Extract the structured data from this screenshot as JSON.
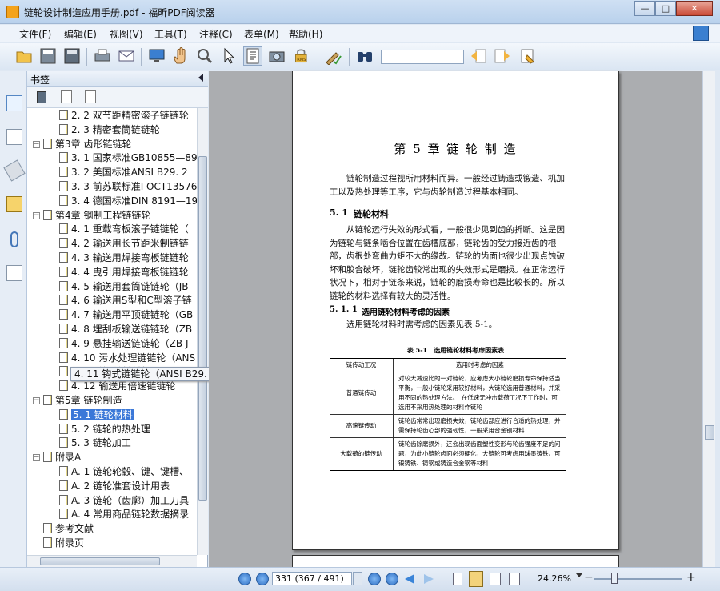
{
  "window": {
    "title": "链轮设计制造应用手册.pdf - 福昕PDF阅读器",
    "min": "—",
    "max": "□",
    "close": "✕"
  },
  "menu": [
    "文件(F)",
    "编辑(E)",
    "视图(V)",
    "工具(T)",
    "注释(C)",
    "表单(M)",
    "帮助(H)"
  ],
  "toolbar": {
    "icons": [
      "open-icon",
      "save-icon",
      "save-all-icon",
      "print-icon",
      "email-icon",
      "fullscreen-icon",
      "hand-icon",
      "zoom-loupe-icon",
      "select-pointer-icon",
      "text-select-icon",
      "snapshot-icon",
      "rms-lock-icon",
      "sign-icon",
      "binoculars-icon",
      "prev-find-icon",
      "next-find-icon",
      "highlight-icon"
    ],
    "search_placeholder": "",
    "rms": "RMS"
  },
  "panel": {
    "title": "书签"
  },
  "tree": [
    {
      "t": "2. 2 双节距精密滚子链链轮",
      "lv": 2
    },
    {
      "t": "2. 3 精密套筒链链轮",
      "lv": 2
    },
    {
      "t": "第3章 齿形链链轮",
      "lv": 1
    },
    {
      "t": "3. 1 国家标准GB10855—89",
      "lv": 2
    },
    {
      "t": "3. 2 美国标准ANSI B29. 2",
      "lv": 2
    },
    {
      "t": "3. 3 前苏联标准ГОСТ13576",
      "lv": 2
    },
    {
      "t": "3. 4 德国标准DIN 8191—19",
      "lv": 2
    },
    {
      "t": "第4章 钢制工程链链轮",
      "lv": 1
    },
    {
      "t": "4. 1 重载弯板滚子链链轮（",
      "lv": 2
    },
    {
      "t": "4. 2 输送用长节距米制链链",
      "lv": 2
    },
    {
      "t": "4. 3 输送用焊接弯板链链轮",
      "lv": 2
    },
    {
      "t": "4. 4 曳引用焊接弯板链链轮",
      "lv": 2
    },
    {
      "t": "4. 5 输送用套筒链链轮（JB",
      "lv": 2
    },
    {
      "t": "4. 6 输送用S型和C型滚子链",
      "lv": 2
    },
    {
      "t": "4. 7 输送用平顶链链轮（GB",
      "lv": 2
    },
    {
      "t": "4. 8 埋刮板输送链链轮（ZB",
      "lv": 2
    },
    {
      "t": "4. 9 悬挂输送链链轮（ZB J",
      "lv": 2
    },
    {
      "t": "4. 10 污水处理链链轮（ANS",
      "lv": 2
    },
    {
      "t": "4. 11 钩式链链轮（ANSI B29. 6—83）",
      "lv": 2
    },
    {
      "t": "4. 12 输送用倍速链链轮",
      "lv": 2
    },
    {
      "t": "第5章 链轮制造",
      "lv": 1
    },
    {
      "t": "5. 1 链轮材料",
      "lv": 2,
      "sel": true
    },
    {
      "t": "5. 2 链轮的热处理",
      "lv": 2
    },
    {
      "t": "5. 3 链轮加工",
      "lv": 2
    },
    {
      "t": "附录A",
      "lv": 1
    },
    {
      "t": "A. 1 链轮轮毂、键、键槽、",
      "lv": 2
    },
    {
      "t": "A. 2 链轮准套设计用表",
      "lv": 2
    },
    {
      "t": "A. 3 链轮（齿廓）加工刀具",
      "lv": 2
    },
    {
      "t": "A. 4 常用商品链轮数据摘录",
      "lv": 2
    },
    {
      "t": "参考文献",
      "lv": 1,
      "leaf": true
    },
    {
      "t": "附录页",
      "lv": 1,
      "leaf": true
    }
  ],
  "tooltip": "4. 11 钩式链链轮（ANSI B29. 6—83）",
  "doc": {
    "chapter": "第 5 章  链 轮 制 造",
    "intro": "链轮制造过程视所用材料而异。一般经过铸造或锻造、机加工以及热处理等工序，它与齿轮制造过程基本相同。",
    "s51_num": "5. 1",
    "s51": "链轮材料",
    "p1": "从链轮运行失效的形式看，一般很少见到齿的折断。这是因为链轮与链条啮合位置在齿槽底部，链轮齿的受力接近齿的根部，齿根处弯曲力矩不大的缘故。链轮的齿面也很少出现点蚀破坏和胶合破坏，链轮齿较常出现的失效形式是磨损。在正常运行状况下，相对于链条来说，链轮的磨损寿命也是比较长的。所以链轮的材料选择有较大的灵活性。",
    "s511_num": "5. 1. 1",
    "s511": "选用链轮材料考虑的因素",
    "p2": "选用链轮材料时需考虑的因素见表 5-1。",
    "table_title": "表 5-1　选用链轮材料考虑因素表",
    "table_head": [
      "链传动工况",
      "选用时考虑的因素"
    ],
    "table_rows": [
      [
        "普通链传动",
        "对较大减速比的一对链轮，应考虑大小链轮磨损寿命保持适当平衡，一般小链轮采用较好材料，大链轮选用普通材料，并采用不同的热处理方法。　在低速无冲击载荷工况下工作时，可选用不采用热处理的材料作链轮"
      ],
      [
        "高速链传动",
        "链轮齿常常出现磨损失效，链轮齿部应进行合适的热处理，并需保持轮齿心部的强韧性，一般采用合金钢材料"
      ],
      [
        "大载荷的链传动",
        "链轮齿除磨损外，还会出现齿面塑性变形与轮齿强度不足的问题，为此小链轮齿面必须硬化，大链轮可考虑用球墨铸铁、可锻铸铁、铸钢或铸造合金钢等材料"
      ]
    ]
  },
  "status": {
    "page": "331 (367 / 491)",
    "zoom": "24.26%",
    "zoom_minus": "−",
    "zoom_plus": "+"
  },
  "colors": {
    "selection": "#3b78d8",
    "toolbar": "#dbe6f3"
  }
}
